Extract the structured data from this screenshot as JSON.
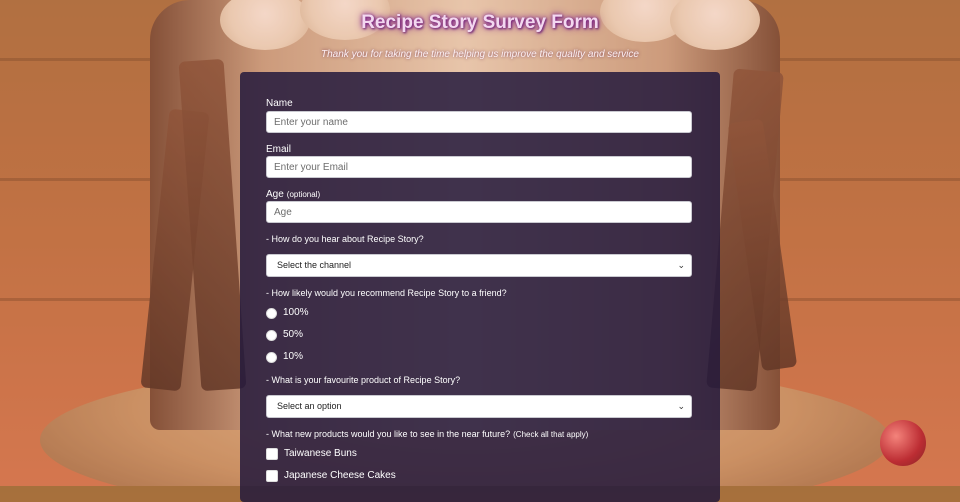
{
  "header": {
    "title": "Recipe Story Survey Form",
    "subtitle": "Thank you for taking the time helping us improve the quality and service"
  },
  "form": {
    "name": {
      "label": "Name",
      "placeholder": "Enter your name"
    },
    "email": {
      "label": "Email",
      "placeholder": "Enter your Email"
    },
    "age": {
      "label": "Age",
      "note": "(optional)",
      "placeholder": "Age"
    },
    "channel": {
      "question": "- How do you hear about Recipe Story?",
      "selected": "Select the channel"
    },
    "recommend": {
      "question": "- How likely would you recommend Recipe Story to a friend?",
      "options": [
        "100%",
        "50%",
        "10%"
      ]
    },
    "favourite": {
      "question": "- What is your favourite product of Recipe Story?",
      "selected": "Select an option"
    },
    "new_products": {
      "question": "- What new products would you like to see in the near future?",
      "note": "(Check all that apply)",
      "options": [
        "Taiwanese Buns",
        "Japanese Cheese Cakes"
      ]
    }
  },
  "icons": {
    "dropdown": "chevron-down-icon"
  }
}
